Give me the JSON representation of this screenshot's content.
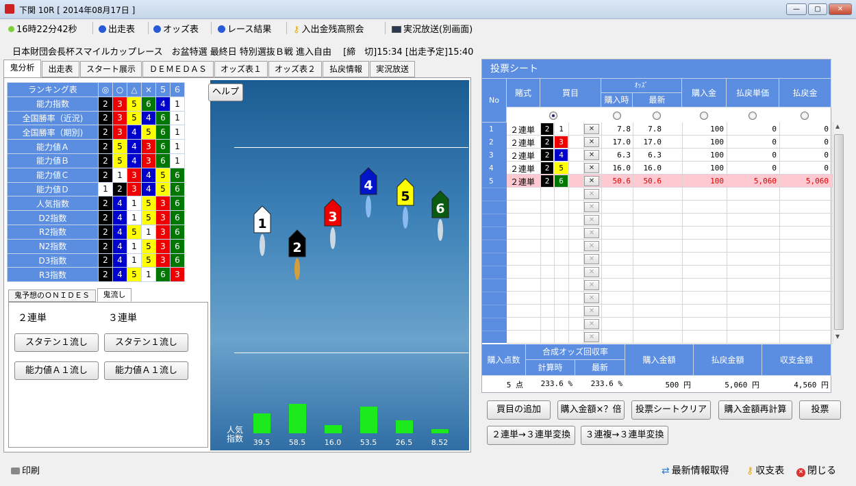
{
  "window": {
    "title": "下関 10R [ 2014年08月17日 ]",
    "minimize": "—",
    "maximize": "▢",
    "close": "✕"
  },
  "toolbar": {
    "clock": "16時22分42秒",
    "entries": "出走表",
    "odds": "オッズ表",
    "results": "レース結果",
    "balance": "入出金残高照会",
    "live": "実況放送(別画面)"
  },
  "race_info": "日本財団会長杯スマイルカップレース　お盆特選 最終日 特別選抜Ｂ戦 進入自由　 [締　切]15:34 [出走予定]15:40",
  "tabs": [
    "鬼分析",
    "出走表",
    "スタート展示",
    "ＤＥＭＥＤＡＳ",
    "オッズ表１",
    "オッズ表２",
    "払戻情報",
    "実況放送"
  ],
  "help_button": "ヘルプ",
  "ranking": {
    "header": [
      "ランキング表",
      "◎",
      "○",
      "△",
      "×",
      "５",
      "６"
    ],
    "rows": [
      {
        "label": "能力指数",
        "vals": [
          "2",
          "3",
          "5",
          "6",
          "4",
          "1"
        ],
        "cls": [
          "k",
          "r",
          "y",
          "g",
          "b",
          "w"
        ]
      },
      {
        "label": "全国勝率（近況)",
        "vals": [
          "2",
          "3",
          "5",
          "4",
          "6",
          "1"
        ],
        "cls": [
          "k",
          "r",
          "y",
          "b",
          "g",
          "w"
        ]
      },
      {
        "label": "全国勝率（期別)",
        "vals": [
          "2",
          "3",
          "4",
          "5",
          "6",
          "1"
        ],
        "cls": [
          "k",
          "r",
          "b",
          "y",
          "g",
          "w"
        ]
      },
      {
        "label": "能力値Ａ",
        "vals": [
          "2",
          "5",
          "4",
          "3",
          "6",
          "1"
        ],
        "cls": [
          "k",
          "y",
          "b",
          "r",
          "g",
          "w"
        ]
      },
      {
        "label": "能力値Ｂ",
        "vals": [
          "2",
          "5",
          "4",
          "3",
          "6",
          "1"
        ],
        "cls": [
          "k",
          "y",
          "b",
          "r",
          "g",
          "w"
        ]
      },
      {
        "label": "能力値Ｃ",
        "vals": [
          "2",
          "1",
          "3",
          "4",
          "5",
          "6"
        ],
        "cls": [
          "k",
          "w",
          "r",
          "b",
          "y",
          "g"
        ]
      },
      {
        "label": "能力値Ｄ",
        "vals": [
          "1",
          "2",
          "3",
          "4",
          "5",
          "6"
        ],
        "cls": [
          "w",
          "k",
          "r",
          "b",
          "y",
          "g"
        ]
      },
      {
        "label": "人気指数",
        "vals": [
          "2",
          "4",
          "1",
          "5",
          "3",
          "6"
        ],
        "cls": [
          "k",
          "b",
          "w",
          "y",
          "r",
          "g"
        ]
      },
      {
        "label": "D2指数",
        "vals": [
          "2",
          "4",
          "1",
          "5",
          "3",
          "6"
        ],
        "cls": [
          "k",
          "b",
          "w",
          "y",
          "r",
          "g"
        ]
      },
      {
        "label": "R2指数",
        "vals": [
          "2",
          "4",
          "5",
          "1",
          "3",
          "6"
        ],
        "cls": [
          "k",
          "b",
          "y",
          "w",
          "r",
          "g"
        ]
      },
      {
        "label": "N2指数",
        "vals": [
          "2",
          "4",
          "1",
          "5",
          "3",
          "6"
        ],
        "cls": [
          "k",
          "b",
          "w",
          "y",
          "r",
          "g"
        ]
      },
      {
        "label": "D3指数",
        "vals": [
          "2",
          "4",
          "1",
          "5",
          "3",
          "6"
        ],
        "cls": [
          "k",
          "b",
          "w",
          "y",
          "r",
          "g"
        ]
      },
      {
        "label": "R3指数",
        "vals": [
          "2",
          "4",
          "5",
          "1",
          "6",
          "3"
        ],
        "cls": [
          "k",
          "b",
          "y",
          "w",
          "g",
          "r"
        ]
      }
    ]
  },
  "subtabs": [
    "鬼予想のＯＮＩＤＥＳ",
    "鬼流し"
  ],
  "oni": {
    "col1": "２連単",
    "col2": "３連単",
    "b1": "スタテン１流し",
    "b2": "スタテン１流し",
    "b3": "能力値Ａ１流し",
    "b4": "能力値Ａ１流し"
  },
  "boats": [
    "1",
    "2",
    "3",
    "4",
    "5",
    "6"
  ],
  "popularity": {
    "label1": "人気",
    "label2": "指数",
    "values": [
      39.5,
      58.5,
      16.0,
      53.5,
      26.5,
      8.52
    ],
    "labels": [
      "39.5",
      "58.5",
      "16.0",
      "53.5",
      "26.5",
      "8.52"
    ]
  },
  "sheet": {
    "title": "投票シート",
    "h_no": "No",
    "h_type": "賭式",
    "h_combo": "買目",
    "h_odds": "ｵｯｽﾞ",
    "h_odds_buy": "購入時",
    "h_odds_now": "最新",
    "h_amount": "購入金",
    "h_unit": "払戻単価",
    "h_refund": "払戻金",
    "rows": [
      {
        "no": "1",
        "type": "２連単",
        "a": "2",
        "b": "1",
        "ac": "k",
        "bc": "w",
        "x": "✕",
        "o1": "7.8",
        "o2": "7.8",
        "amt": "100",
        "unit": "0",
        "ref": "0"
      },
      {
        "no": "2",
        "type": "２連単",
        "a": "2",
        "b": "3",
        "ac": "k",
        "bc": "r",
        "x": "✕",
        "o1": "17.0",
        "o2": "17.0",
        "amt": "100",
        "unit": "0",
        "ref": "0"
      },
      {
        "no": "3",
        "type": "２連単",
        "a": "2",
        "b": "4",
        "ac": "k",
        "bc": "b",
        "x": "✕",
        "o1": "6.3",
        "o2": "6.3",
        "amt": "100",
        "unit": "0",
        "ref": "0"
      },
      {
        "no": "4",
        "type": "２連単",
        "a": "2",
        "b": "5",
        "ac": "k",
        "bc": "y",
        "x": "✕",
        "o1": "16.0",
        "o2": "16.0",
        "amt": "100",
        "unit": "0",
        "ref": "0"
      },
      {
        "no": "5",
        "type": "２連単",
        "a": "2",
        "b": "6",
        "ac": "k",
        "bc": "g",
        "x": "✕",
        "o1": "50.6",
        "o2": "50.6",
        "amt": "100",
        "unit": "5,060",
        "ref": "5,060"
      }
    ],
    "empty_x": "✕"
  },
  "summary": {
    "h_points": "購入点数",
    "h_rate": "合成オッズ回収率",
    "h_rate_buy": "計算時",
    "h_rate_now": "最新",
    "h_buy": "購入金額",
    "h_ref": "払戻金額",
    "h_bal": "収支金額",
    "points": "5 点",
    "rate_buy": "233.6 %",
    "rate_now": "233.6 %",
    "buy": "500 円",
    "ref": "5,060 円",
    "bal": "4,560 円"
  },
  "actions": [
    "買目の追加",
    "購入金額×？倍",
    "投票シートクリア",
    "購入金額再計算",
    "投票",
    "２連単→３連単変換",
    "３連複→３連単変換"
  ],
  "footer": {
    "print": "印刷",
    "refresh": "最新情報取得",
    "ledger": "収支表",
    "close": "閉じる"
  }
}
